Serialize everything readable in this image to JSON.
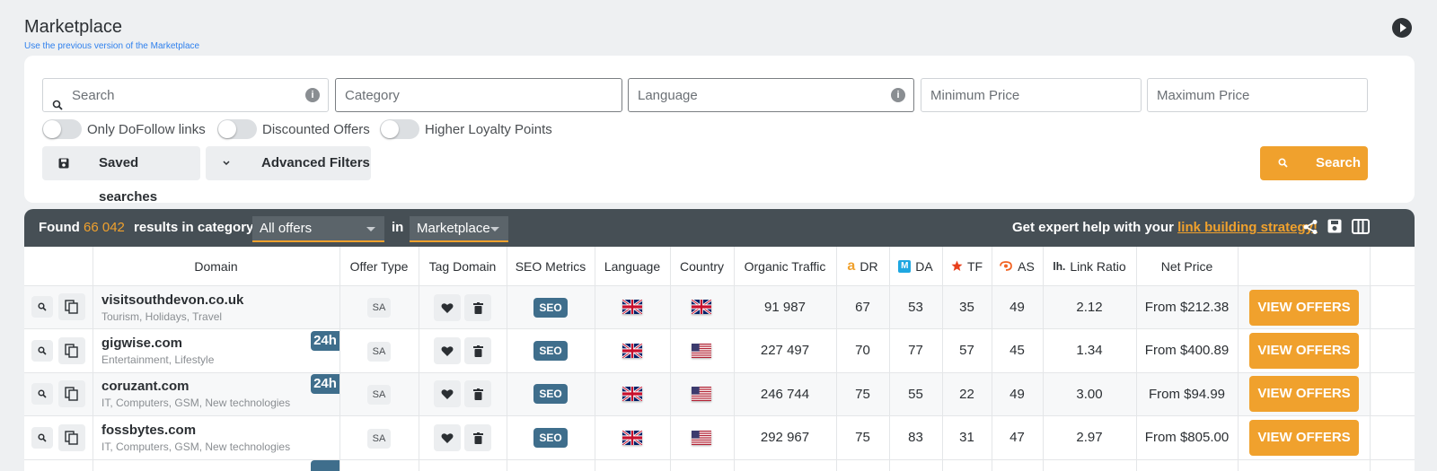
{
  "header": {
    "title": "Marketplace",
    "prev_link": "Use the previous version of the Marketplace"
  },
  "filters": {
    "search_placeholder": "Search",
    "category_placeholder": "Category",
    "language_placeholder": "Language",
    "min_price_placeholder": "Minimum Price",
    "max_price_placeholder": "Maximum Price",
    "info_glyph": "i",
    "toggles": [
      "Only DoFollow links",
      "Discounted Offers",
      "Higher Loyalty Points"
    ],
    "saved_searches_label": "Saved searches",
    "advanced_filters_label": "Advanced Filters",
    "search_button_label": "Search"
  },
  "results": {
    "found_label": "Found",
    "count": "66 042",
    "results_label": "results in category",
    "category_value": "All offers",
    "in_label": "in",
    "scope_value": "Marketplace",
    "help_prefix": "Get expert help with your",
    "help_link": "link building strategy!"
  },
  "table": {
    "headers": {
      "domain": "Domain",
      "offer_type": "Offer Type",
      "tag_domain": "Tag Domain",
      "seo_metrics": "SEO Metrics",
      "language": "Language",
      "country": "Country",
      "organic_traffic": "Organic Traffic",
      "dr": "DR",
      "da": "DA",
      "tf": "TF",
      "as": "AS",
      "link_ratio": "Link Ratio",
      "net_price": "Net Price"
    },
    "header_icon_text": {
      "dr": "a",
      "da": "M",
      "link_ratio": "lh."
    },
    "rows": [
      {
        "domain": "visitsouthdevon.co.uk",
        "category": "Tourism, Holidays, Travel",
        "badge": "",
        "offer_type": "SA",
        "seo": "SEO",
        "language": "gb",
        "country": "gb",
        "traffic": "91 987",
        "dr": "67",
        "da": "53",
        "tf": "35",
        "as": "49",
        "ratio": "2.12",
        "price": "From $212.38",
        "cta": "VIEW OFFERS"
      },
      {
        "domain": "gigwise.com",
        "category": "Entertainment, Lifestyle",
        "badge": "24h",
        "offer_type": "SA",
        "seo": "SEO",
        "language": "gb",
        "country": "us",
        "traffic": "227 497",
        "dr": "70",
        "da": "77",
        "tf": "57",
        "as": "45",
        "ratio": "1.34",
        "price": "From $400.89",
        "cta": "VIEW OFFERS"
      },
      {
        "domain": "coruzant.com",
        "category": "IT, Computers, GSM, New technologies",
        "badge": "24h",
        "offer_type": "SA",
        "seo": "SEO",
        "language": "gb",
        "country": "us",
        "traffic": "246 744",
        "dr": "75",
        "da": "55",
        "tf": "22",
        "as": "49",
        "ratio": "3.00",
        "price": "From $94.99",
        "cta": "VIEW OFFERS"
      },
      {
        "domain": "fossbytes.com",
        "category": "IT, Computers, GSM, New technologies",
        "badge": "",
        "offer_type": "SA",
        "seo": "SEO",
        "language": "gb",
        "country": "us",
        "traffic": "292 967",
        "dr": "75",
        "da": "83",
        "tf": "31",
        "as": "47",
        "ratio": "2.97",
        "price": "From $805.00",
        "cta": "VIEW OFFERS"
      }
    ]
  },
  "colors": {
    "accent": "#f0a12d",
    "dark_bar": "#464f55",
    "seo_badge": "#3f6e8c"
  }
}
